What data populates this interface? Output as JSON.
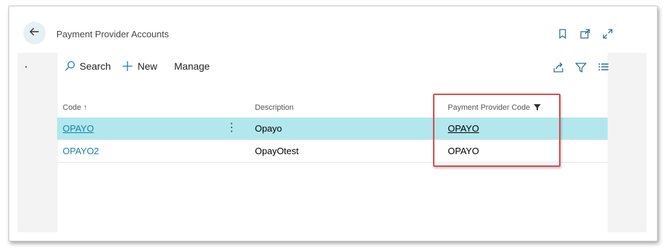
{
  "header": {
    "title": "Payment Provider Accounts",
    "icons": [
      "bookmark-icon",
      "open-in-new-window-icon",
      "expand-icon"
    ]
  },
  "toolbar": {
    "search_label": "Search",
    "new_label": "New",
    "manage_label": "Manage",
    "right_icons": [
      "share-icon",
      "filter-icon",
      "list-view-icon"
    ]
  },
  "table": {
    "columns": [
      "Code",
      "Description",
      "Payment Provider Code"
    ],
    "sort_indicator": "↑",
    "rows": [
      {
        "code": "OPAYO",
        "description": "Opayo",
        "provider_code": "OPAYO",
        "selected": true
      },
      {
        "code": "OPAYO2",
        "description": "OpayOtest",
        "provider_code": "OPAYO",
        "selected": false
      }
    ]
  },
  "colors": {
    "accent": "#1a7fa6",
    "selected_row": "#b2e7ee",
    "highlight_border": "#d94a4a"
  }
}
